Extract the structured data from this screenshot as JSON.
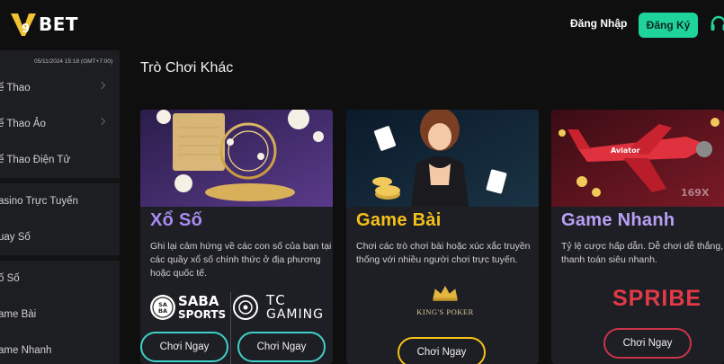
{
  "header": {
    "logo_text": "BET",
    "login_label": "Đăng Nhập",
    "register_label": "Đăng Ký"
  },
  "sidebar": {
    "datetime": "05/11/2024 15:18 (GMT+7:00)",
    "items": [
      {
        "label": "ể Thao"
      },
      {
        "label": "ể Thao Ảo"
      },
      {
        "label": "ể Thao Điện Tử"
      },
      {
        "label": "asino Trực Tuyến"
      },
      {
        "label": "uay Số"
      },
      {
        "label": "ố Số"
      },
      {
        "label": "ame Bài"
      },
      {
        "label": "ame Nhanh"
      }
    ]
  },
  "main": {
    "section_title": "Trò Chơi Khác",
    "cards": [
      {
        "title": "Xổ Số",
        "desc_line1": "Ghi lại cảm hứng về các con số của bạn tại",
        "desc_line2": "các quầy xổ số chính thức ở địa phương",
        "desc_line3": "hoặc quốc tế.",
        "provider1": "SABA",
        "provider1_sub": "SPORTS",
        "provider2": "TC",
        "provider2_sub": "GAMING",
        "play_label_1": "Chơi Ngay",
        "play_label_2": "Chơi Ngay"
      },
      {
        "title": "Game Bài",
        "desc_line1": "Chơi các trò chơi bài hoặc xúc xắc truyền",
        "desc_line2": "thống với nhiều người chơi trực tuyến.",
        "provider": "KING'S POKER",
        "play_label": "Chơi Ngay"
      },
      {
        "title": "Game Nhanh",
        "desc_line1": "Tỷ lệ cược hấp dẫn. Dễ chơi dễ thắng,",
        "desc_line2": "thanh toán siêu nhanh.",
        "provider": "SPRIBE",
        "plane_label": "Aviator",
        "multiplier": "169X",
        "play_label": "Chơi Ngay"
      }
    ]
  },
  "colors": {
    "accent_green": "#1ed49a",
    "lottery_title": "#a98bf2",
    "cards_title": "#f3c21a",
    "fast_title": "#b9a0f5",
    "teal_button": "#3fd0c9",
    "gold_button": "#f3c21a",
    "red_button": "#c9344a"
  }
}
